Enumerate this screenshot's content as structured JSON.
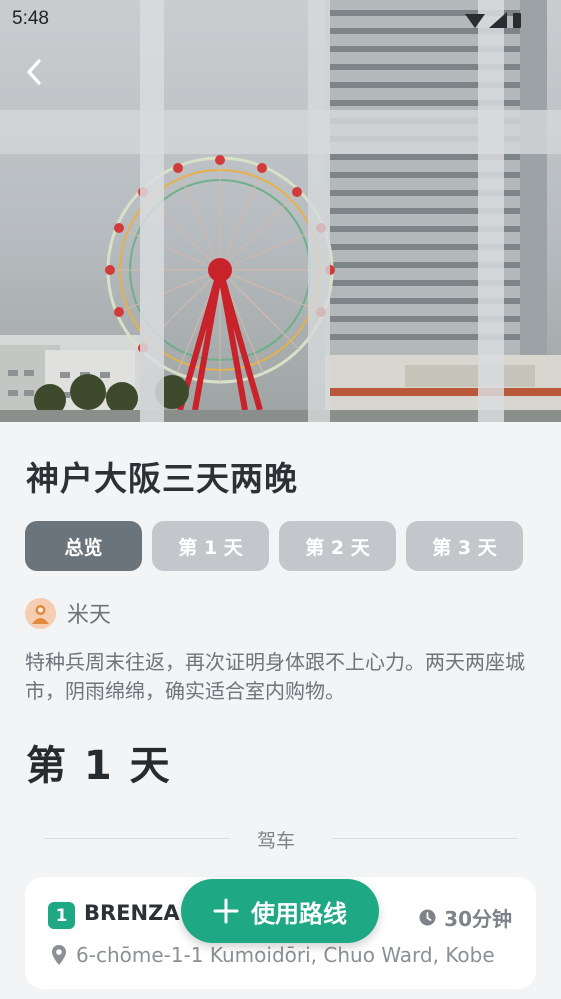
{
  "status_bar": {
    "time": "5:48"
  },
  "header": {
    "back_icon": "chevron-left-icon"
  },
  "trip": {
    "title": "神户大阪三天两晚",
    "tabs": [
      {
        "label": "总览",
        "active": true
      },
      {
        "label": "第 1 天",
        "active": false
      },
      {
        "label": "第 2 天",
        "active": false
      },
      {
        "label": "第 3 天",
        "active": false
      }
    ],
    "author": {
      "name": "米天",
      "avatar_icon": "avatar-icon"
    },
    "description": "特种兵周末往返，再次证明身体跟不上心力。两天两座城市，阴雨绵绵，确实适合室内购物。"
  },
  "day": {
    "heading": "第 1 天",
    "transport_mode": "驾车",
    "stops": [
      {
        "number": "1",
        "name": "BRENZA",
        "duration": "30分钟",
        "address": "6-chōme-1-1 Kumoidōri, Chuo Ward, Kobe"
      }
    ]
  },
  "fab": {
    "label": "使用路线",
    "icon": "plus-icon"
  },
  "colors": {
    "accent": "#1fa884",
    "tab_active": "#6b737b",
    "tab_inactive": "#c3c7cb"
  }
}
